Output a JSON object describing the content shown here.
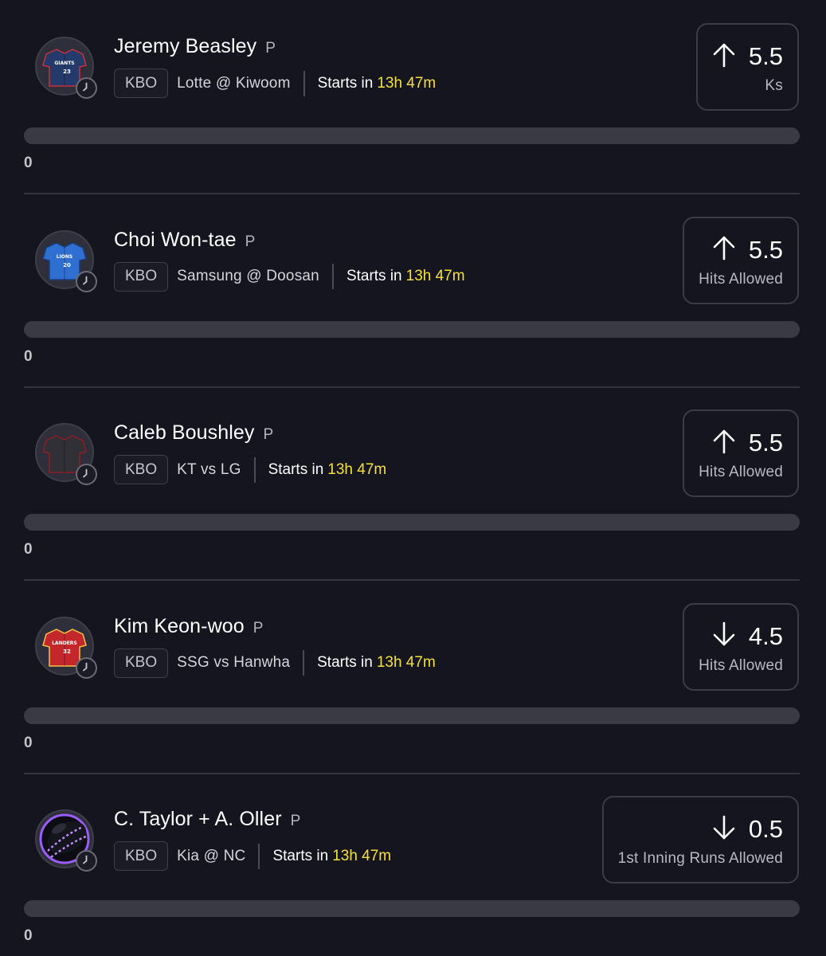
{
  "colors": {
    "background": "#15151f",
    "accent_time": "#f4e13b",
    "progress_track": "#393a44"
  },
  "props": [
    {
      "player": "Jeremy Beasley",
      "position": "P",
      "league": "KBO",
      "matchup": "Lotte  @  Kiwoom",
      "starts_label": "Starts in",
      "starts_time": "13h 47m",
      "direction": "up",
      "direction_icon": "arrow-up-icon",
      "line": "5.5",
      "stat": "Ks",
      "progress": 0,
      "count": "0",
      "jersey": {
        "color": "#243a6b",
        "trim": "#c4323a",
        "text": "GIANTS",
        "number": "23"
      }
    },
    {
      "player": "Choi Won-tae",
      "position": "P",
      "league": "KBO",
      "matchup": "Samsung  @  Doosan",
      "starts_label": "Starts in",
      "starts_time": "13h 47m",
      "direction": "up",
      "direction_icon": "arrow-up-icon",
      "line": "5.5",
      "stat": "Hits Allowed",
      "progress": 0,
      "count": "0",
      "jersey": {
        "color": "#2e6fd1",
        "trim": "#1b3d7a",
        "text": "LIONS",
        "number": "20"
      }
    },
    {
      "player": "Caleb Boushley",
      "position": "P",
      "league": "KBO",
      "matchup": "KT vs LG",
      "starts_label": "Starts in",
      "starts_time": "13h 47m",
      "direction": "up",
      "direction_icon": "arrow-up-icon",
      "line": "5.5",
      "stat": "Hits Allowed",
      "progress": 0,
      "count": "0",
      "jersey": {
        "color": "#303036",
        "trim": "#8a1e24",
        "text": "",
        "number": ""
      }
    },
    {
      "player": "Kim Keon-woo",
      "position": "P",
      "league": "KBO",
      "matchup": "SSG vs Hanwha",
      "starts_label": "Starts in",
      "starts_time": "13h 47m",
      "direction": "down",
      "direction_icon": "arrow-down-icon",
      "line": "4.5",
      "stat": "Hits Allowed",
      "progress": 0,
      "count": "0",
      "jersey": {
        "color": "#c3262b",
        "trim": "#f0c24a",
        "text": "LANDERS",
        "number": "32"
      }
    },
    {
      "player": "C. Taylor + A. Oller",
      "position": "P",
      "league": "KBO",
      "matchup": "Kia  @  NC",
      "starts_label": "Starts in",
      "starts_time": "13h 47m",
      "direction": "down",
      "direction_icon": "arrow-down-icon",
      "line": "0.5",
      "stat": "1st Inning Runs Allowed",
      "progress": 0,
      "count": "0",
      "jersey": null
    }
  ]
}
